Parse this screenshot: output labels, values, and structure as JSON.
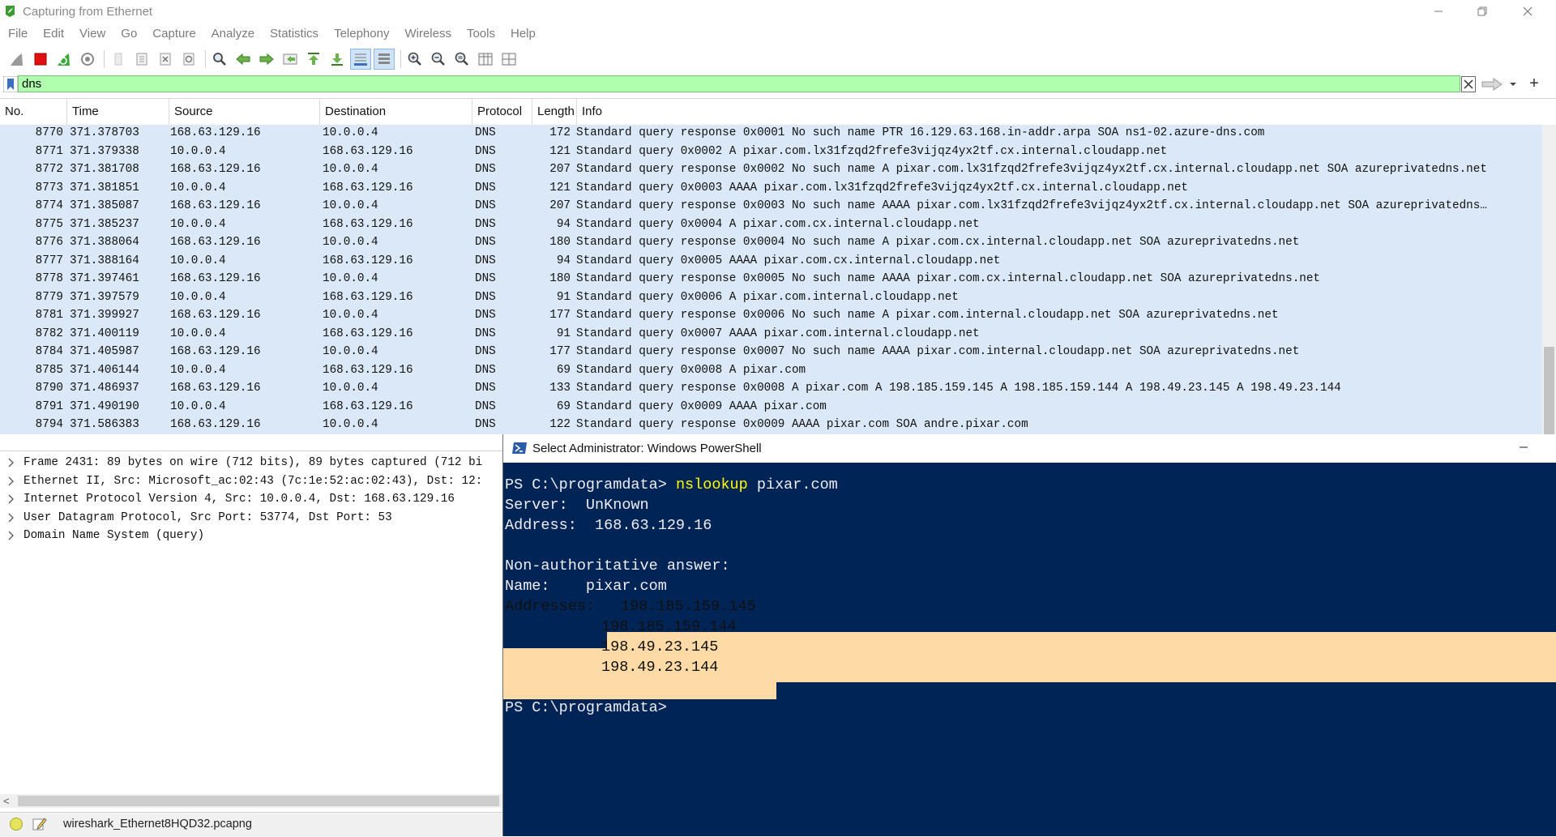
{
  "window": {
    "title": "Capturing from Ethernet",
    "controls": [
      "minimize",
      "restore",
      "close"
    ]
  },
  "menu": [
    "File",
    "Edit",
    "View",
    "Go",
    "Capture",
    "Analyze",
    "Statistics",
    "Telephony",
    "Wireless",
    "Tools",
    "Help"
  ],
  "toolbar": {
    "icons": [
      "shark-fin-start-icon",
      "stop-capture-icon",
      "restart-capture-icon",
      "capture-options-icon",
      "open-file-icon",
      "save-file-icon",
      "close-file-icon",
      "reload-file-icon",
      "find-packet-icon",
      "go-back-icon",
      "go-forward-icon",
      "go-to-packet-icon",
      "go-first-icon",
      "go-last-icon",
      "autoscroll-icon",
      "colorize-icon",
      "zoom-in-icon",
      "zoom-out-icon",
      "normal-size-icon",
      "resize-columns-icon",
      "layout-icon"
    ]
  },
  "filter": {
    "value": "dns",
    "color": "#afffaf"
  },
  "packet_list": {
    "columns": [
      "No.",
      "Time",
      "Source",
      "Destination",
      "Protocol",
      "Length",
      "Info"
    ],
    "rows": [
      {
        "no": "8770",
        "time": "371.378703",
        "src": "168.63.129.16",
        "dst": "10.0.0.4",
        "proto": "DNS",
        "len": "172",
        "info": "Standard query response 0x0001 No such name PTR 16.129.63.168.in-addr.arpa SOA ns1-02.azure-dns.com"
      },
      {
        "no": "8771",
        "time": "371.379338",
        "src": "10.0.0.4",
        "dst": "168.63.129.16",
        "proto": "DNS",
        "len": "121",
        "info": "Standard query 0x0002 A pixar.com.lx31fzqd2frefe3vijqz4yx2tf.cx.internal.cloudapp.net"
      },
      {
        "no": "8772",
        "time": "371.381708",
        "src": "168.63.129.16",
        "dst": "10.0.0.4",
        "proto": "DNS",
        "len": "207",
        "info": "Standard query response 0x0002 No such name A pixar.com.lx31fzqd2frefe3vijqz4yx2tf.cx.internal.cloudapp.net SOA azureprivatedns.net"
      },
      {
        "no": "8773",
        "time": "371.381851",
        "src": "10.0.0.4",
        "dst": "168.63.129.16",
        "proto": "DNS",
        "len": "121",
        "info": "Standard query 0x0003 AAAA pixar.com.lx31fzqd2frefe3vijqz4yx2tf.cx.internal.cloudapp.net"
      },
      {
        "no": "8774",
        "time": "371.385087",
        "src": "168.63.129.16",
        "dst": "10.0.0.4",
        "proto": "DNS",
        "len": "207",
        "info": "Standard query response 0x0003 No such name AAAA pixar.com.lx31fzqd2frefe3vijqz4yx2tf.cx.internal.cloudapp.net SOA azureprivatedns…"
      },
      {
        "no": "8775",
        "time": "371.385237",
        "src": "10.0.0.4",
        "dst": "168.63.129.16",
        "proto": "DNS",
        "len": "94",
        "info": "Standard query 0x0004 A pixar.com.cx.internal.cloudapp.net"
      },
      {
        "no": "8776",
        "time": "371.388064",
        "src": "168.63.129.16",
        "dst": "10.0.0.4",
        "proto": "DNS",
        "len": "180",
        "info": "Standard query response 0x0004 No such name A pixar.com.cx.internal.cloudapp.net SOA azureprivatedns.net"
      },
      {
        "no": "8777",
        "time": "371.388164",
        "src": "10.0.0.4",
        "dst": "168.63.129.16",
        "proto": "DNS",
        "len": "94",
        "info": "Standard query 0x0005 AAAA pixar.com.cx.internal.cloudapp.net"
      },
      {
        "no": "8778",
        "time": "371.397461",
        "src": "168.63.129.16",
        "dst": "10.0.0.4",
        "proto": "DNS",
        "len": "180",
        "info": "Standard query response 0x0005 No such name AAAA pixar.com.cx.internal.cloudapp.net SOA azureprivatedns.net"
      },
      {
        "no": "8779",
        "time": "371.397579",
        "src": "10.0.0.4",
        "dst": "168.63.129.16",
        "proto": "DNS",
        "len": "91",
        "info": "Standard query 0x0006 A pixar.com.internal.cloudapp.net"
      },
      {
        "no": "8781",
        "time": "371.399927",
        "src": "168.63.129.16",
        "dst": "10.0.0.4",
        "proto": "DNS",
        "len": "177",
        "info": "Standard query response 0x0006 No such name A pixar.com.internal.cloudapp.net SOA azureprivatedns.net"
      },
      {
        "no": "8782",
        "time": "371.400119",
        "src": "10.0.0.4",
        "dst": "168.63.129.16",
        "proto": "DNS",
        "len": "91",
        "info": "Standard query 0x0007 AAAA pixar.com.internal.cloudapp.net"
      },
      {
        "no": "8784",
        "time": "371.405987",
        "src": "168.63.129.16",
        "dst": "10.0.0.4",
        "proto": "DNS",
        "len": "177",
        "info": "Standard query response 0x0007 No such name AAAA pixar.com.internal.cloudapp.net SOA azureprivatedns.net"
      },
      {
        "no": "8785",
        "time": "371.406144",
        "src": "10.0.0.4",
        "dst": "168.63.129.16",
        "proto": "DNS",
        "len": "69",
        "info": "Standard query 0x0008 A pixar.com"
      },
      {
        "no": "8790",
        "time": "371.486937",
        "src": "168.63.129.16",
        "dst": "10.0.0.4",
        "proto": "DNS",
        "len": "133",
        "info": "Standard query response 0x0008 A pixar.com A 198.185.159.145 A 198.185.159.144 A 198.49.23.145 A 198.49.23.144"
      },
      {
        "no": "8791",
        "time": "371.490190",
        "src": "10.0.0.4",
        "dst": "168.63.129.16",
        "proto": "DNS",
        "len": "69",
        "info": "Standard query 0x0009 AAAA pixar.com"
      },
      {
        "no": "8794",
        "time": "371.586383",
        "src": "168.63.129.16",
        "dst": "10.0.0.4",
        "proto": "DNS",
        "len": "122",
        "info": "Standard query response 0x0009 AAAA pixar.com SOA andre.pixar.com"
      }
    ],
    "row_color": "#dae8f7"
  },
  "details": [
    "Frame 2431: 89 bytes on wire (712 bits), 89 bytes captured (712 bi",
    "Ethernet II, Src: Microsoft_ac:02:43 (7c:1e:52:ac:02:43), Dst: 12:",
    "Internet Protocol Version 4, Src: 10.0.0.4, Dst: 168.63.129.16",
    "User Datagram Protocol, Src Port: 53774, Dst Port: 53",
    "Domain Name System (query)"
  ],
  "status": {
    "file": "wireshark_Ethernet8HQD32.pcapng"
  },
  "powershell": {
    "title": "Select Administrator: Windows PowerShell",
    "prompt1": "PS C:\\programdata> ",
    "command": "nslookup",
    "command_arg": " pixar.com",
    "server_line": "Server:  UnKnown",
    "address_line": "Address:  168.63.129.16",
    "nonauth_line": "Non-authoritative answer:",
    "name_line": "Name:    pixar.com",
    "addresses_label": "Addresses:",
    "addresses": [
      "198.185.159.145",
      "198.185.159.144",
      "198.49.23.145",
      "198.49.23.144"
    ],
    "prompt2": "PS C:\\programdata>",
    "background": "#012456",
    "selection_color": "#fedba6"
  }
}
